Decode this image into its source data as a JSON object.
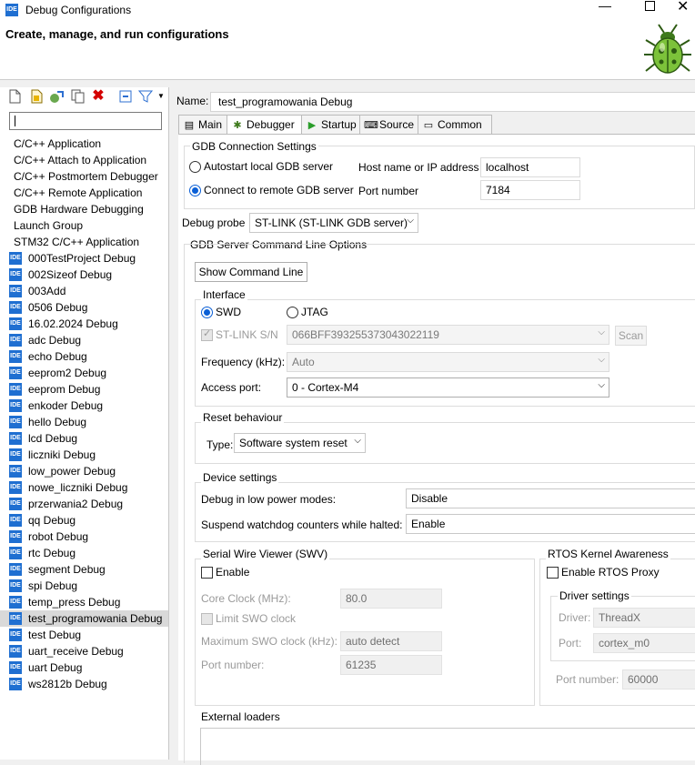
{
  "window": {
    "badge": "IDE",
    "title": "Debug Configurations",
    "minimize": "—",
    "close": "✕"
  },
  "banner": {
    "title": "Create, manage, and run configurations"
  },
  "left": {
    "toolbar_icons": [
      "new-config-icon",
      "new-prototype-icon",
      "export-icon",
      "duplicate-icon",
      "delete-icon",
      "collapse-all-icon",
      "filter-icon",
      "dropdown-icon"
    ],
    "filter_value": "",
    "types": [
      "C/C++ Application",
      "C/C++ Attach to Application",
      "C/C++ Postmortem Debugger",
      "C/C++ Remote Application",
      "GDB Hardware Debugging",
      "Launch Group",
      "STM32 C/C++ Application"
    ],
    "configs": [
      "000TestProject Debug",
      "002Sizeof Debug",
      "003Add",
      "0506 Debug",
      "16.02.2024 Debug",
      "adc Debug",
      "echo Debug",
      "eeprom2 Debug",
      "eeprom Debug",
      "enkoder Debug",
      "hello Debug",
      "lcd Debug",
      "liczniki Debug",
      "low_power Debug",
      "nowe_liczniki Debug",
      "przerwania2 Debug",
      "qq Debug",
      "robot Debug",
      "rtc Debug",
      "segment Debug",
      "spi Debug",
      "temp_press Debug",
      "test_programowania Debug",
      "test Debug",
      "uart_receive Debug",
      "uart Debug",
      "ws2812b Debug"
    ],
    "selected_index": 22
  },
  "name": {
    "label": "Name:",
    "value": "test_programowania Debug"
  },
  "tabs": [
    "Main",
    "Debugger",
    "Startup",
    "Source",
    "Common"
  ],
  "active_tab": "Debugger",
  "gdb": {
    "title": "GDB Connection Settings",
    "autostart_label": "Autostart local GDB server",
    "remote_label": "Connect to remote GDB server",
    "host_label": "Host name or IP address",
    "host_value": "localhost",
    "port_label": "Port number",
    "port_value": "7184"
  },
  "probe": {
    "label": "Debug probe",
    "value": "ST-LINK (ST-LINK GDB server)"
  },
  "server": {
    "title": "GDB Server Command Line Options",
    "show_cmd_label": "Show Command Line",
    "interface_title": "Interface",
    "swd_label": "SWD",
    "jtag_label": "JTAG",
    "stlink_sn_label": "ST-LINK S/N",
    "stlink_sn_value": "066BFF393255373043022119",
    "scan_label": "Scan",
    "freq_label": "Frequency (kHz):",
    "freq_value": "Auto",
    "access_port_label": "Access port:",
    "access_port_value": "0 - Cortex-M4",
    "reset_title": "Reset behaviour",
    "reset_type_label": "Type:",
    "reset_type_value": "Software system reset",
    "device_title": "Device settings",
    "low_power_label": "Debug in low power modes:",
    "low_power_value": "Disable",
    "watchdog_label": "Suspend watchdog counters while halted:",
    "watchdog_value": "Enable"
  },
  "swv": {
    "title": "Serial Wire Viewer (SWV)",
    "enable_label": "Enable",
    "core_clock_label": "Core Clock (MHz):",
    "core_clock_value": "80.0",
    "limit_label": "Limit SWO clock",
    "max_swo_label": "Maximum SWO clock (kHz):",
    "max_swo_value": "auto detect",
    "port_label": "Port number:",
    "port_value": "61235"
  },
  "rtos": {
    "title": "RTOS Kernel Awareness",
    "enable_label": "Enable RTOS Proxy",
    "driver_settings_title": "Driver settings",
    "driver_label": "Driver:",
    "driver_value": "ThreadX",
    "port_label": "Port:",
    "port_value": "cortex_m0",
    "port_number_label": "Port number:",
    "port_number_value": "60000"
  },
  "external": {
    "title": "External loaders"
  }
}
